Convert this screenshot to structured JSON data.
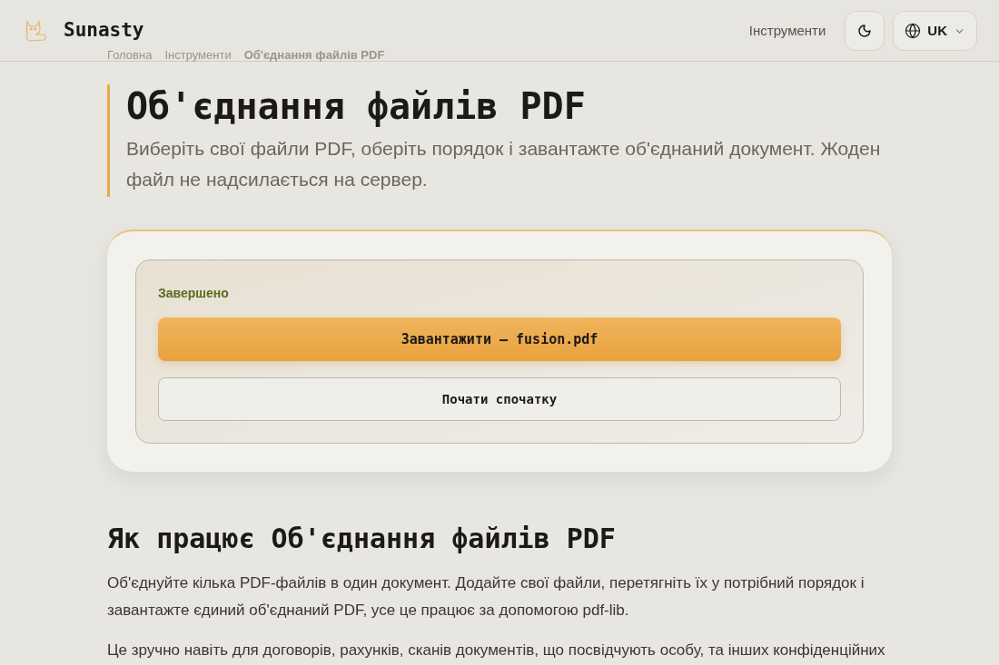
{
  "header": {
    "brand": "Sunasty",
    "nav_link": "Інструменти",
    "language": "UK"
  },
  "breadcrumb": [
    "Головна",
    "Інструменти",
    "Об'єднання файлів PDF"
  ],
  "page": {
    "title": "Об'єднання файлів PDF",
    "subtitle": "Виберіть свої файли PDF, оберіть порядок і завантажте об'єднаний документ. Жоден файл не надсилається на сервер."
  },
  "merge_card": {
    "status": "Завершено",
    "download_button": "Завантажити — fusion.pdf",
    "restart_button": "Почати спочатку"
  },
  "how_it_works": {
    "heading": "Як працює Об'єднання файлів PDF",
    "paragraphs": [
      "Об'єднуйте кілька PDF-файлів в один документ. Додайте свої файли, перетягніть їх у потрібний порядок і завантажте єдиний об'єднаний PDF, усе це працює за допомогою pdf-lib.",
      "Це зручно навіть для договорів, рахунків, сканів документів, що посвідчують особу, та інших конфіденційних"
    ]
  }
}
